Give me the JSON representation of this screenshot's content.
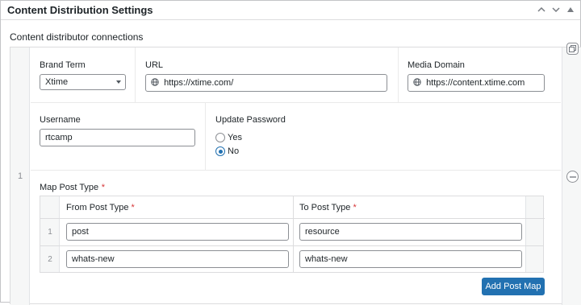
{
  "panel": {
    "title": "Content Distribution Settings",
    "header_buttons": [
      {
        "icon": "chevron-up-icon",
        "glyph": "⌃"
      },
      {
        "icon": "chevron-down-icon",
        "glyph": "⌄"
      },
      {
        "icon": "arrow-up-icon",
        "glyph": "▲"
      }
    ]
  },
  "section_label": "Content distributor connections",
  "repeater": {
    "row_index": "1",
    "duplicate_icon": "duplicate-icon",
    "remove_icon": "remove-row-icon",
    "brand_term": {
      "label": "Brand Term",
      "value": "Xtime"
    },
    "url": {
      "label": "URL",
      "value": "https://xtime.com/"
    },
    "media_domain": {
      "label": "Media Domain",
      "value": "https://content.xtime.com"
    },
    "username": {
      "label": "Username",
      "value": "rtcamp"
    },
    "update_password": {
      "label": "Update Password",
      "options": [
        {
          "label": "Yes",
          "checked": false
        },
        {
          "label": "No",
          "checked": true
        }
      ]
    },
    "map_post_type": {
      "label": "Map Post Type",
      "required_mark": "*",
      "columns": {
        "from": "From Post Type",
        "to": "To Post Type",
        "required_mark": "*"
      },
      "rows": [
        {
          "index": "1",
          "from": "post",
          "to": "resource"
        },
        {
          "index": "2",
          "from": "whats-new",
          "to": "whats-new"
        }
      ],
      "add_button": "Add Post Map"
    }
  },
  "colors": {
    "accent": "#2271b1",
    "required": "#d63638",
    "border": "#dcdcde"
  }
}
